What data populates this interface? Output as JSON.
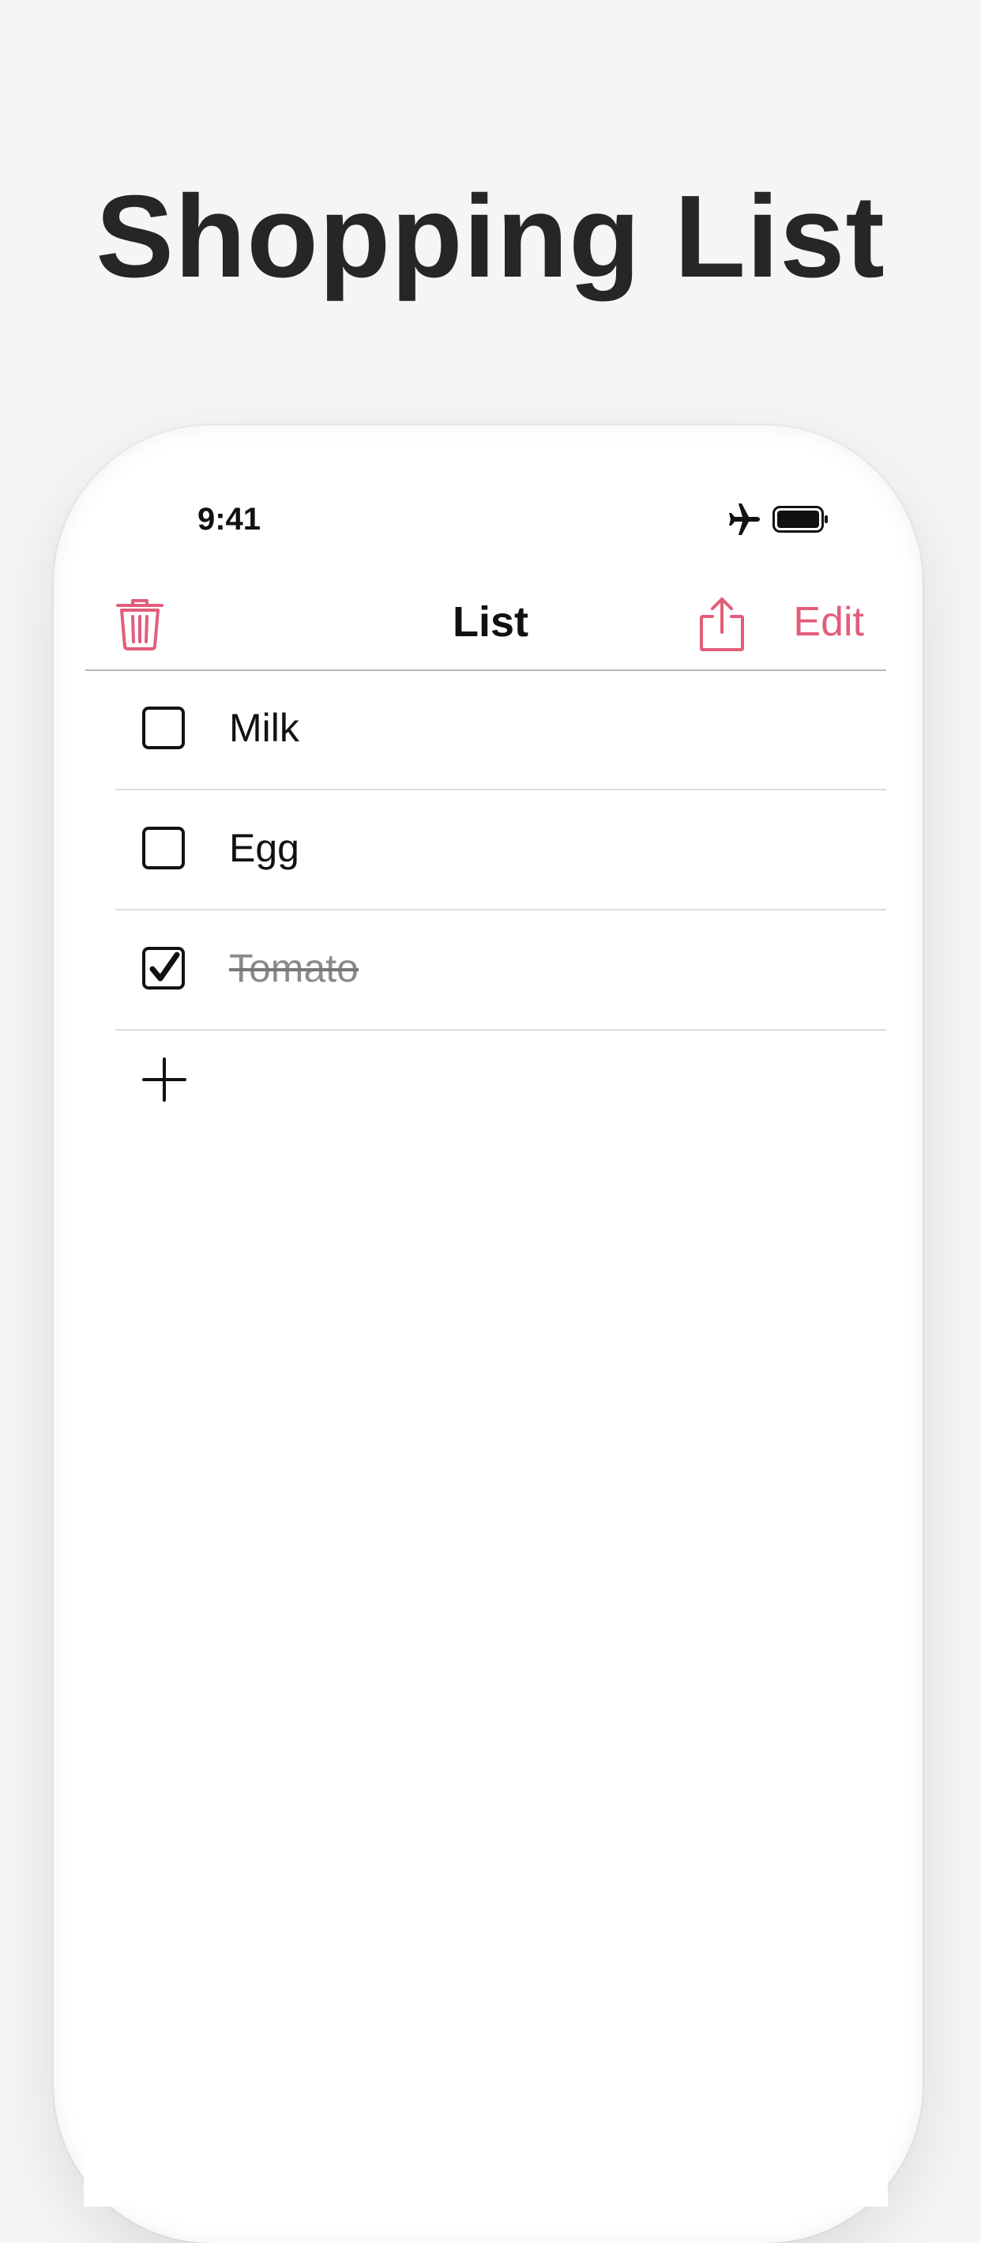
{
  "headline": "Shopping List",
  "status_bar": {
    "time": "9:41",
    "icons": [
      "airplane-icon",
      "battery-icon"
    ]
  },
  "nav_bar": {
    "title": "List",
    "left_icon": "trash-icon",
    "right_icon": "share-icon",
    "edit_label": "Edit"
  },
  "list": {
    "items": [
      {
        "label": "Milk",
        "checked": false
      },
      {
        "label": "Egg",
        "checked": false
      },
      {
        "label": "Tomato",
        "checked": true
      }
    ],
    "add_icon": "plus-icon"
  },
  "colors": {
    "accent": "#e35d7a",
    "text": "#111111",
    "checked_text": "#8a8a8e",
    "background": "#f5f5f7"
  }
}
